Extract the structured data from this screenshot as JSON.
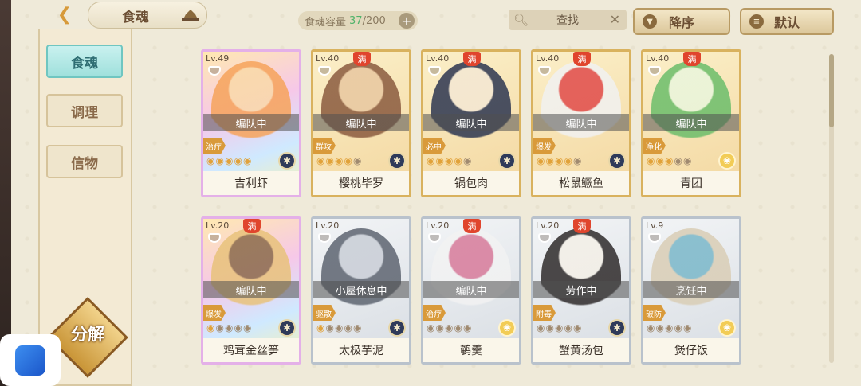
{
  "header": {
    "title": "食魂",
    "capacity_label": "食魂容量",
    "capacity_current": "37",
    "capacity_total": "/200",
    "search_placeholder": "查找",
    "sort_label": "降序",
    "default_label": "默认"
  },
  "sidebar": {
    "items": [
      {
        "label": "食魂",
        "active": true
      },
      {
        "label": "调理",
        "active": false
      },
      {
        "label": "信物",
        "active": false
      }
    ],
    "decompose_label": "分解"
  },
  "cards": [
    {
      "level": "Lv.49",
      "full": false,
      "status": "编队中",
      "role": "治疗",
      "stars": 5,
      "name": "吉利虾",
      "element": "dark",
      "rarity": "rainbow"
    },
    {
      "level": "Lv.40",
      "full": true,
      "status": "编队中",
      "role": "群攻",
      "stars": 4,
      "name": "樱桃毕罗",
      "element": "dark",
      "rarity": "gold"
    },
    {
      "level": "Lv.40",
      "full": true,
      "status": "编队中",
      "role": "必中",
      "stars": 4,
      "name": "锅包肉",
      "element": "dark",
      "rarity": "gold"
    },
    {
      "level": "Lv.40",
      "full": true,
      "status": "编队中",
      "role": "爆发",
      "stars": 4,
      "name": "松鼠鳜鱼",
      "element": "dark",
      "rarity": "gold"
    },
    {
      "level": "Lv.40",
      "full": true,
      "status": "编队中",
      "role": "净化",
      "stars": 3,
      "name": "青团",
      "element": "light",
      "rarity": "gold"
    },
    {
      "level": "Lv.20",
      "full": true,
      "status": "编队中",
      "role": "爆发",
      "stars": 1,
      "name": "鸡茸金丝笋",
      "element": "dark",
      "rarity": "rainbow"
    },
    {
      "level": "Lv.20",
      "full": false,
      "status": "小屋休息中",
      "role": "驱散",
      "stars": 1,
      "name": "太极芋泥",
      "element": "dark",
      "rarity": "silver"
    },
    {
      "level": "Lv.20",
      "full": true,
      "status": "编队中",
      "role": "治疗",
      "stars": 0,
      "name": "鹌羹",
      "element": "light",
      "rarity": "silver"
    },
    {
      "level": "Lv.20",
      "full": true,
      "status": "劳作中",
      "role": "附毒",
      "stars": 0,
      "name": "蟹黄汤包",
      "element": "dark",
      "rarity": "silver"
    },
    {
      "level": "Lv.9",
      "full": false,
      "status": "烹饪中",
      "role": "破防",
      "stars": 0,
      "name": "煲仔饭",
      "element": "light",
      "rarity": "silver"
    }
  ],
  "full_badge_label": "满",
  "colors": {
    "accent_teal": "#9fe0dc",
    "gold_border": "#d9b25e",
    "full_badge": "#e0452d"
  }
}
